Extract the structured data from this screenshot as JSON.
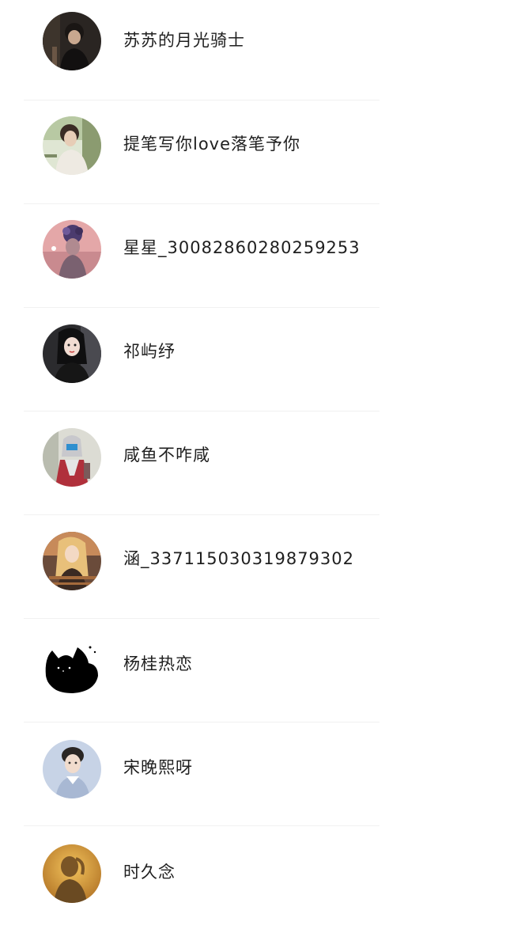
{
  "contacts": [
    {
      "name": "苏苏的月光骑士",
      "avatar_icon": "avatar-dark-portrait-icon"
    },
    {
      "name": "提笔写你love落笔予你",
      "avatar_icon": "avatar-boy-outdoor-icon"
    },
    {
      "name": "星星_30082860280259253",
      "avatar_icon": "avatar-flower-crown-icon"
    },
    {
      "name": "祁屿纾",
      "avatar_icon": "avatar-girl-black-hair-icon"
    },
    {
      "name": "咸鱼不咋咸",
      "avatar_icon": "avatar-mecha-hero-icon"
    },
    {
      "name": "涵_33711503031987930​2",
      "avatar_icon": "avatar-blonde-girl-icon"
    },
    {
      "name": "杨桂热恋",
      "avatar_icon": "avatar-black-cat-icon"
    },
    {
      "name": "宋晚熙呀",
      "avatar_icon": "avatar-young-man-icon"
    },
    {
      "name": "时久念",
      "avatar_icon": "avatar-silhouette-icon"
    }
  ],
  "colors": {
    "background": "#ffffff",
    "text": "#1f1f1f",
    "divider": "#f1f1f1"
  }
}
